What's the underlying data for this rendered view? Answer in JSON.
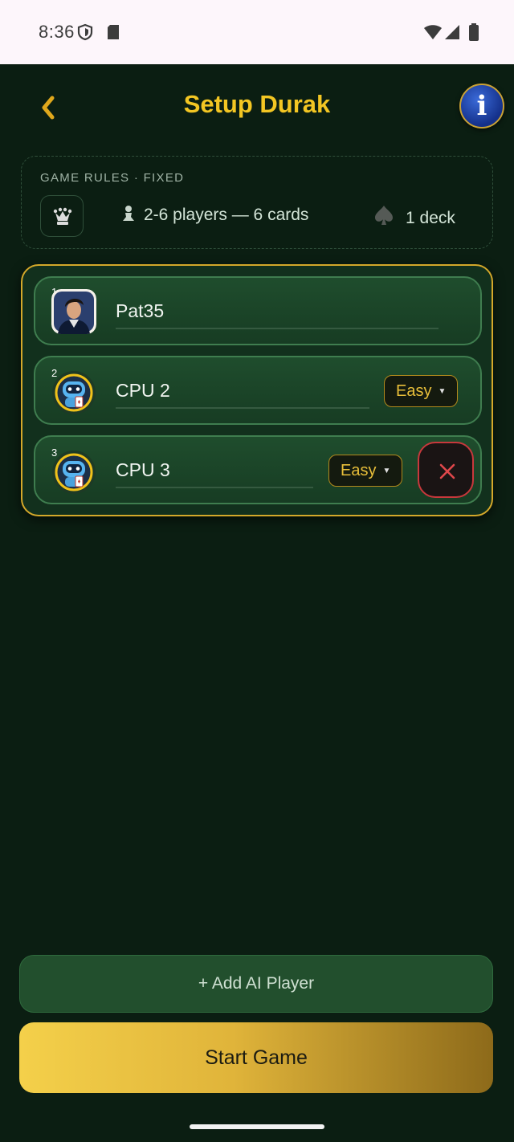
{
  "status_bar": {
    "time": "8:36"
  },
  "header": {
    "title": "Setup Durak"
  },
  "rules": {
    "label": "GAME RULES · FIXED",
    "players_text": "2-6 players — 6 cards",
    "deck_text": "1 deck"
  },
  "players": [
    {
      "number": "1",
      "name": "Pat35",
      "type": "human"
    },
    {
      "number": "2",
      "name": "CPU 2",
      "type": "cpu",
      "difficulty": "Easy"
    },
    {
      "number": "3",
      "name": "CPU 3",
      "type": "cpu",
      "difficulty": "Easy"
    }
  ],
  "actions": {
    "add_ai_label": "+ Add AI Player",
    "start_label": "Start Game"
  },
  "colors": {
    "background": "#0b1e12",
    "accent_gold": "#f3c623",
    "remove_red": "#c8383c",
    "row_green": "#1f4d2d"
  }
}
